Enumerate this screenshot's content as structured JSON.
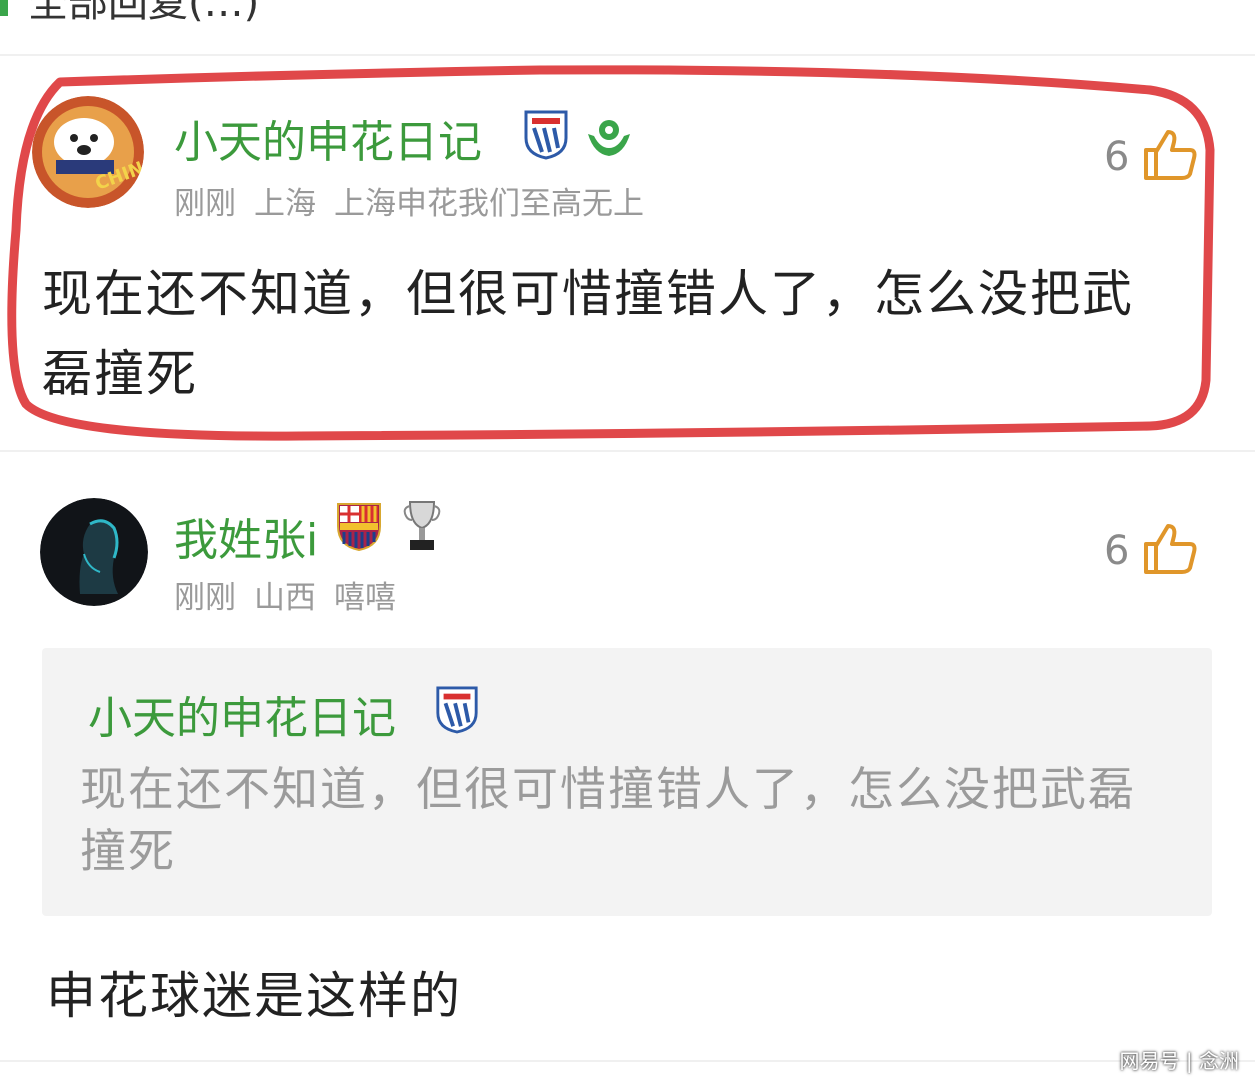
{
  "header": {
    "partial_title": "全部回复(…)"
  },
  "comment1": {
    "username": "小天的申花日记",
    "meta": [
      "刚刚",
      "上海",
      "上海申花我们至高无上"
    ],
    "like_count": "6",
    "body": "现在还不知道，但很可惜撞错人了，怎么没把武磊撞死",
    "avatar_text": "CHINA",
    "avatar": "cartoon-dog-dragon-avatar",
    "badges": [
      "shenhua-shield-icon",
      "green-ball-hands-icon"
    ]
  },
  "comment2": {
    "username": "我姓张i",
    "meta": [
      "刚刚",
      "山西",
      "嘻嘻"
    ],
    "like_count": "6",
    "avatar": "dark-profile-silhouette-avatar",
    "badges": [
      "fcb-crest-icon",
      "trophy-icon"
    ],
    "quote": {
      "username": "小天的申花日记",
      "text": "现在还不知道，但很可惜撞错人了，怎么没把武磊撞死"
    },
    "reply": "申花球迷是这样的"
  },
  "watermark": "网易号 | 念洲",
  "colors": {
    "accent_green": "#3c9a3c",
    "highlight_red": "#e0484a",
    "meta_gray": "#9a9a9a"
  }
}
